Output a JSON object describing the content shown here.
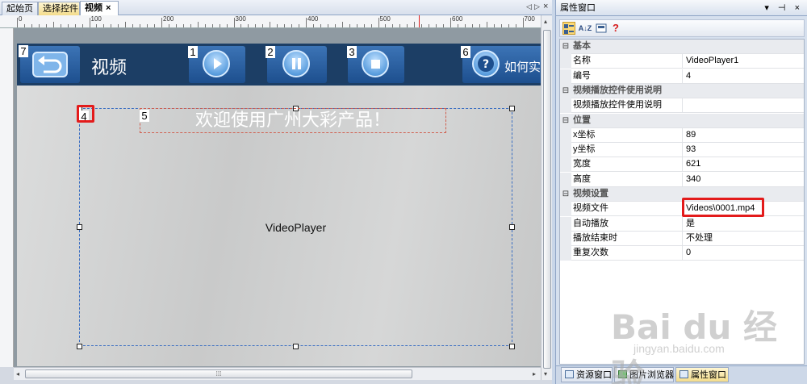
{
  "editor": {
    "tabs": [
      {
        "label": "起始页"
      },
      {
        "label": "选择控件"
      },
      {
        "label": "视频",
        "close": "×"
      }
    ],
    "tab_nav": {
      "left": "◁",
      "right": "▷",
      "close": "×"
    },
    "ruler_labels": [
      "0",
      "100",
      "200",
      "300",
      "400",
      "500",
      "600",
      "700"
    ],
    "screen": {
      "title": "视频",
      "how_text": "如何实",
      "welcome_text": "欢迎使用广州大彩产品！",
      "video_placeholder": "VideoPlayer",
      "buttons": [
        {
          "num": "7",
          "icon": "back-arrow-icon"
        },
        {
          "num": "1",
          "icon": "play-icon"
        },
        {
          "num": "2",
          "icon": "pause-icon"
        },
        {
          "num": "3",
          "icon": "stop-icon"
        },
        {
          "num": "6",
          "icon": "help-icon"
        }
      ],
      "labels": {
        "video_num": "4",
        "text_num": "5"
      }
    },
    "scroll_grip": "⁞⁞⁞"
  },
  "properties": {
    "title": "属性窗口",
    "title_controls": "▾ ⊣ ×",
    "toolbar": {
      "sort_az": "A↓Z",
      "help": "?"
    },
    "rows": [
      {
        "type": "cat",
        "toggle": "⊟",
        "name": "基本"
      },
      {
        "name": "名称",
        "value": "VideoPlayer1"
      },
      {
        "name": "编号",
        "value": "4"
      },
      {
        "type": "cat",
        "toggle": "⊟",
        "name": "视频播放控件使用说明"
      },
      {
        "name": "视频播放控件使用说明",
        "value": ""
      },
      {
        "type": "cat",
        "toggle": "⊟",
        "name": "位置"
      },
      {
        "name": "x坐标",
        "value": "89"
      },
      {
        "name": "y坐标",
        "value": "93"
      },
      {
        "name": "宽度",
        "value": "621"
      },
      {
        "name": "高度",
        "value": "340"
      },
      {
        "type": "cat",
        "toggle": "⊟",
        "name": "视频设置"
      },
      {
        "name": "视频文件",
        "value": "Videos\\0001.mp4"
      },
      {
        "name": "自动播放",
        "value": "是"
      },
      {
        "name": "播放结束时",
        "value": "不处理"
      },
      {
        "name": "重复次数",
        "value": "0"
      }
    ],
    "bottom_tabs": [
      {
        "label": "资源窗口"
      },
      {
        "label": "图片浏览器"
      },
      {
        "label": "属性窗口"
      }
    ]
  },
  "watermark": {
    "text": "Bai du 经验",
    "sub": "jingyan.baidu.com"
  },
  "colors": {
    "topbar": "#1c3e65",
    "button": "#2d63a3",
    "highlight": "#e31b1b",
    "selection": "#3a6ec2"
  }
}
